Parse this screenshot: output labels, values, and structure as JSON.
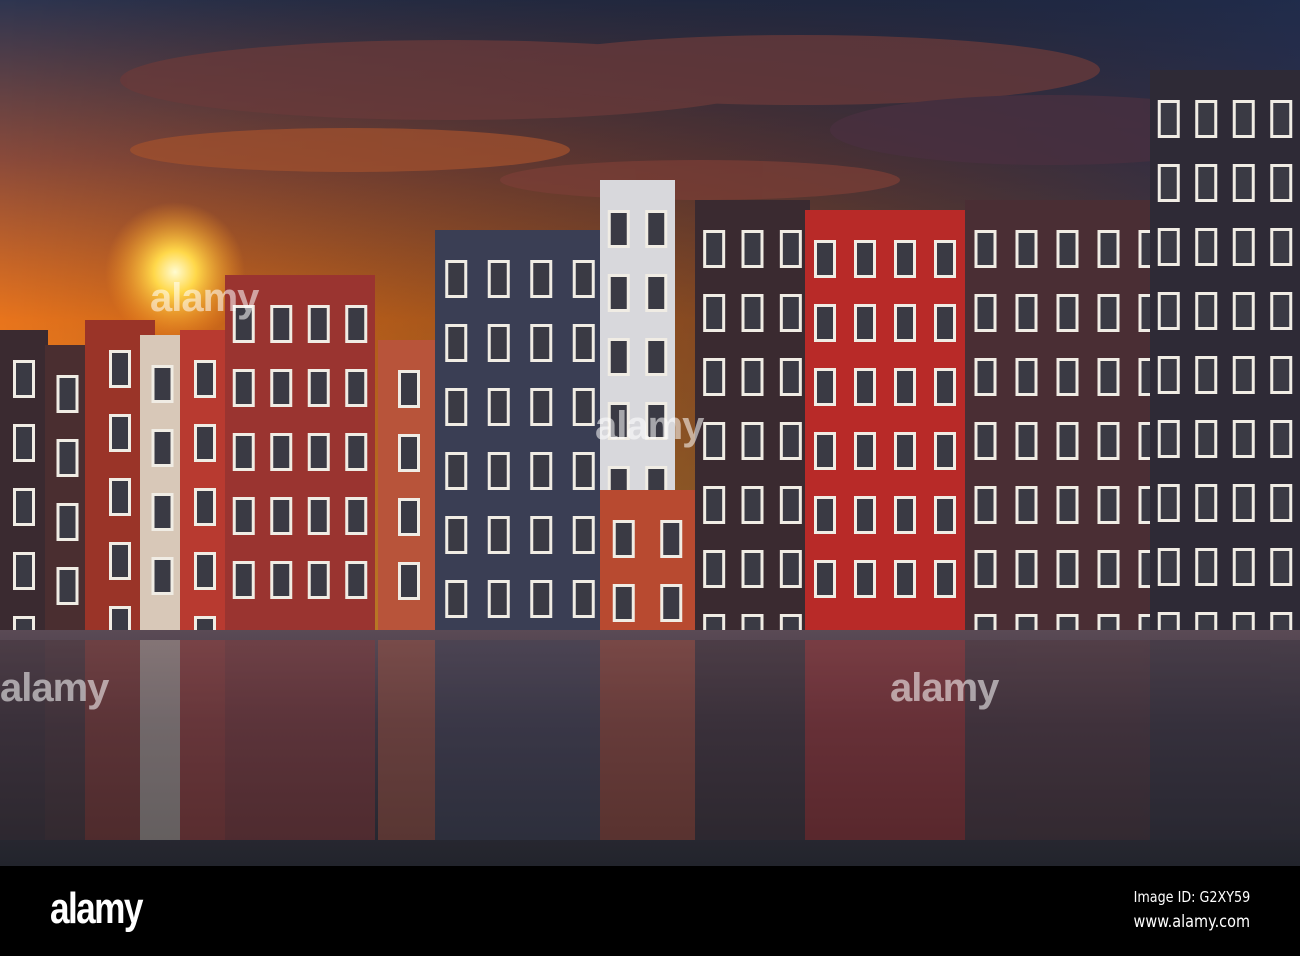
{
  "watermark": {
    "brand": "alamy"
  },
  "footer": {
    "logo": "alamy",
    "image_id": "Image ID: G2XY59",
    "url": "www.alamy.com"
  }
}
